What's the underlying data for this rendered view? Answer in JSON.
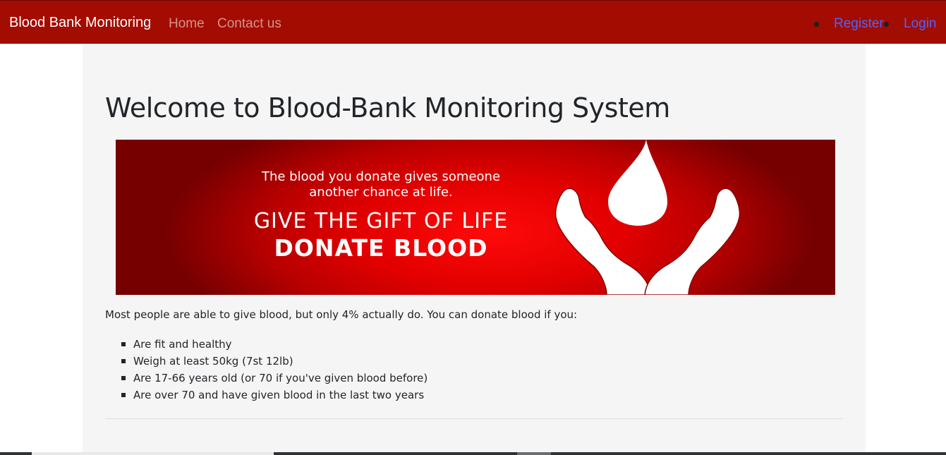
{
  "navbar": {
    "brand": "Blood Bank Monitoring",
    "links": [
      {
        "label": "Home"
      },
      {
        "label": "Contact us"
      }
    ],
    "right_links": [
      {
        "label": "Register"
      },
      {
        "label": "Login"
      }
    ],
    "colors": {
      "background": "#a30c00",
      "link_muted": "rgba(255,255,255,0.55)",
      "link_right": "#4a66ff"
    }
  },
  "main": {
    "title": "Welcome to Blood-Bank Monitoring System",
    "banner": {
      "line1": "The blood you donate gives someone",
      "line2": "another chance at life.",
      "headline": "GIVE THE GIFT OF LIFE",
      "subheadline": "DONATE BLOOD",
      "icons": [
        "blood-drop-icon",
        "hands-icon"
      ]
    },
    "intro": "Most people are able to give blood, but only 4% actually do. You can donate blood if you:",
    "requirements": [
      "Are fit and healthy",
      "Weigh at least 50kg (7st 12lb)",
      "Are 17-66 years old (or 70 if you've given blood before)",
      "Are over 70 and have given blood in the last two years"
    ]
  }
}
